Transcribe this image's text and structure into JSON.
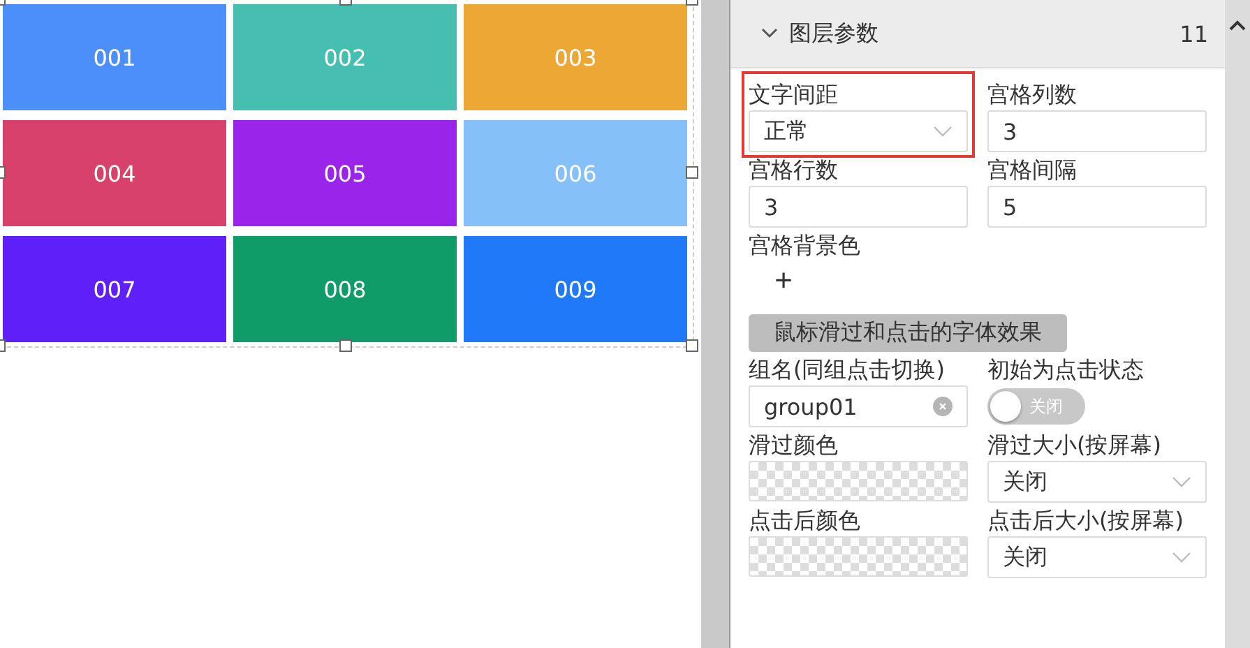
{
  "canvas": {
    "selected": true,
    "cells": [
      {
        "label": "001",
        "color": "#4c8ffb"
      },
      {
        "label": "002",
        "color": "#46bfb0"
      },
      {
        "label": "003",
        "color": "#eda734"
      },
      {
        "label": "004",
        "color": "#d7416a"
      },
      {
        "label": "005",
        "color": "#9b24eb"
      },
      {
        "label": "006",
        "color": "#85c1f8"
      },
      {
        "label": "007",
        "color": "#5e1ff8"
      },
      {
        "label": "008",
        "color": "#0f9c68"
      },
      {
        "label": "009",
        "color": "#1f79f8"
      }
    ]
  },
  "panel": {
    "title": "图层参数",
    "count": "11",
    "expanded": true,
    "fields": [
      {
        "kind": "select",
        "label": "文字间距",
        "value": "正常",
        "highlighted": true
      },
      {
        "kind": "input",
        "label": "宫格列数",
        "value": "3",
        "highlighted": false
      },
      {
        "kind": "input",
        "label": "宫格行数",
        "value": "3",
        "highlighted": false
      },
      {
        "kind": "input",
        "label": "宫格间隔",
        "value": "5",
        "highlighted": false
      },
      {
        "kind": "add",
        "label": "宫格背景色",
        "value": "+",
        "highlighted": false
      }
    ],
    "section_button": "鼠标滑过和点击的字体效果",
    "effect_fields": [
      {
        "kind": "clear-input",
        "label": "组名(同组点击切换)",
        "value": "group01",
        "highlighted": false
      },
      {
        "kind": "toggle",
        "label": "初始为点击状态",
        "value": "关闭",
        "on": false,
        "highlighted": false
      },
      {
        "kind": "color",
        "label": "滑过颜色",
        "highlighted": false
      },
      {
        "kind": "select",
        "label": "滑过大小(按屏幕)",
        "value": "关闭",
        "highlighted": false
      },
      {
        "kind": "color",
        "label": "点击后颜色",
        "highlighted": false
      },
      {
        "kind": "select",
        "label": "点击后大小(按屏幕)",
        "value": "关闭",
        "highlighted": false
      }
    ]
  }
}
